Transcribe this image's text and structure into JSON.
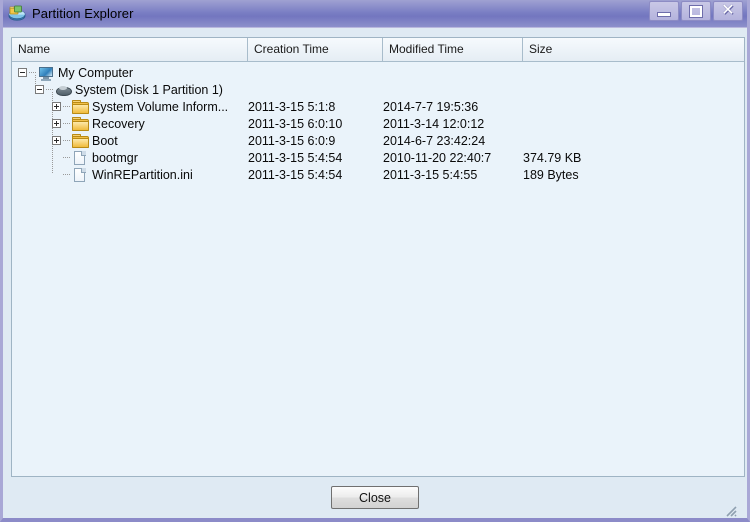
{
  "window": {
    "title": "Partition Explorer",
    "app_icon": "partition-disk-icon",
    "controls": {
      "minimize": "minimize-icon",
      "maximize": "maximize-icon",
      "close": "✕"
    }
  },
  "listview": {
    "columns": [
      {
        "id": "name",
        "label": "Name"
      },
      {
        "id": "ctime",
        "label": "Creation Time"
      },
      {
        "id": "mtime",
        "label": "Modified Time"
      },
      {
        "id": "size",
        "label": "Size"
      }
    ],
    "rows": [
      {
        "name": "My Computer",
        "icon": "computer-icon",
        "depth": 0,
        "expander": "minus",
        "creation_time": "",
        "modified_time": "",
        "size": ""
      },
      {
        "name": "System (Disk 1 Partition 1)",
        "icon": "disk-icon",
        "depth": 1,
        "expander": "minus",
        "creation_time": "",
        "modified_time": "",
        "size": ""
      },
      {
        "name": "System Volume Inform...",
        "icon": "folder-icon",
        "depth": 2,
        "expander": "plus",
        "creation_time": "2011-3-15 5:1:8",
        "modified_time": "2014-7-7 19:5:36",
        "size": ""
      },
      {
        "name": "Recovery",
        "icon": "folder-icon",
        "depth": 2,
        "expander": "plus",
        "creation_time": "2011-3-15 6:0:10",
        "modified_time": "2011-3-14 12:0:12",
        "size": ""
      },
      {
        "name": "Boot",
        "icon": "folder-icon",
        "depth": 2,
        "expander": "plus",
        "creation_time": "2011-3-15 6:0:9",
        "modified_time": "2014-6-7 23:42:24",
        "size": ""
      },
      {
        "name": "bootmgr",
        "icon": "file-icon",
        "depth": 2,
        "expander": "none",
        "creation_time": "2011-3-15 5:4:54",
        "modified_time": "2010-11-20 22:40:7",
        "size": "374.79 KB"
      },
      {
        "name": "WinREPartition.ini",
        "icon": "file-icon",
        "depth": 2,
        "expander": "none",
        "creation_time": "2011-3-15 5:4:54",
        "modified_time": "2011-3-15 5:4:55",
        "size": "189 Bytes"
      }
    ]
  },
  "footer": {
    "close_label": "Close"
  },
  "colors": {
    "titlebar": "#7b7fc4",
    "window_bg": "#dfeaf3",
    "list_bg": "#eaf3fa",
    "header_bg": "#eef4f9",
    "border": "#9fb4c4",
    "folder": "#f0bb3c"
  }
}
